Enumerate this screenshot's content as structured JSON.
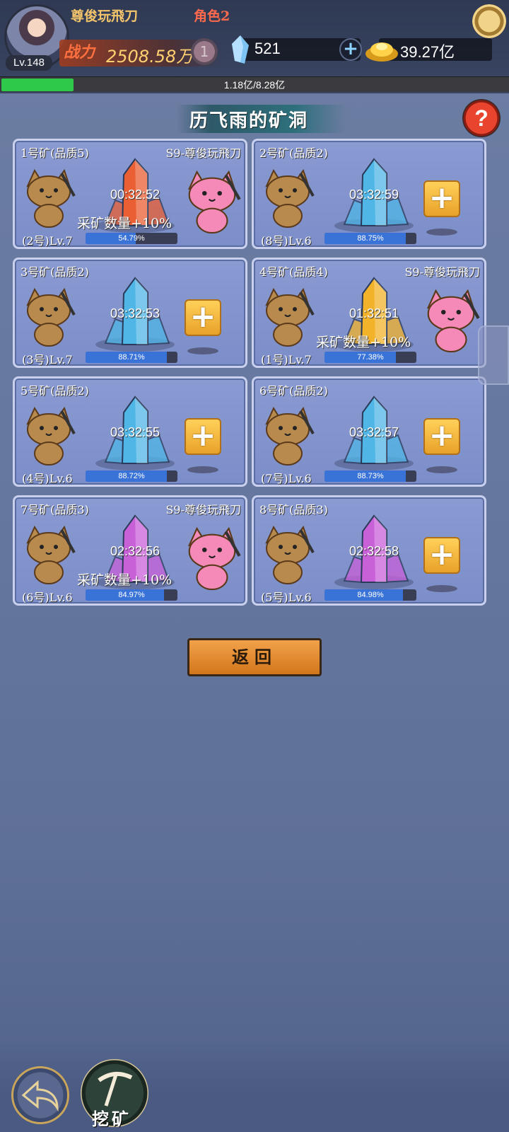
{
  "header": {
    "player_name": "尊俊玩飛刀",
    "role_label": "角色2",
    "level": "Lv.148",
    "power_label": "战力",
    "power_value": "2508.58万",
    "vip_number": "1",
    "gems": "521",
    "gold": "39.27亿",
    "exp_text": "1.18亿/8.28亿",
    "exp_fraction": 0.1425
  },
  "title": "历飞雨的矿洞",
  "help_label": "?",
  "mines": [
    {
      "title": "1号矿(品质5)",
      "owner": "S9-尊俊玩飛刀",
      "timer": "00:32:52",
      "bonus": "采矿数量+10%",
      "worker": "(2号)Lv.7",
      "progress": "54.79%",
      "fraction": 0.5479,
      "crystal": "#ea5f33",
      "occupied": true
    },
    {
      "title": "2号矿(品质2)",
      "owner": "",
      "timer": "03:32:59",
      "bonus": "",
      "worker": "(8号)Lv.6",
      "progress": "88.75%",
      "fraction": 0.8875,
      "crystal": "#4fb6e6",
      "occupied": false
    },
    {
      "title": "3号矿(品质2)",
      "owner": "",
      "timer": "03:32:53",
      "bonus": "",
      "worker": "(3号)Lv.7",
      "progress": "88.71%",
      "fraction": 0.8871,
      "crystal": "#4fb6e6",
      "occupied": false
    },
    {
      "title": "4号矿(品质4)",
      "owner": "S9-尊俊玩飛刀",
      "timer": "01:32:51",
      "bonus": "采矿数量+10%",
      "worker": "(1号)Lv.7",
      "progress": "77.38%",
      "fraction": 0.7738,
      "crystal": "#f2b22a",
      "occupied": true
    },
    {
      "title": "5号矿(品质2)",
      "owner": "",
      "timer": "03:32:55",
      "bonus": "",
      "worker": "(4号)Lv.6",
      "progress": "88.72%",
      "fraction": 0.8872,
      "crystal": "#4fb6e6",
      "occupied": false
    },
    {
      "title": "6号矿(品质2)",
      "owner": "",
      "timer": "03:32:57",
      "bonus": "",
      "worker": "(7号)Lv.6",
      "progress": "88.73%",
      "fraction": 0.8873,
      "crystal": "#4fb6e6",
      "occupied": false
    },
    {
      "title": "7号矿(品质3)",
      "owner": "S9-尊俊玩飛刀",
      "timer": "02:32:56",
      "bonus": "采矿数量+10%",
      "worker": "(6号)Lv.6",
      "progress": "84.97%",
      "fraction": 0.8497,
      "crystal": "#c860d8",
      "occupied": true
    },
    {
      "title": "8号矿(品质3)",
      "owner": "",
      "timer": "02:32:58",
      "bonus": "",
      "worker": "(5号)Lv.6",
      "progress": "84.98%",
      "fraction": 0.8498,
      "crystal": "#c860d8",
      "occupied": false
    }
  ],
  "return_label": "返回",
  "mine_button_label": "挖矿",
  "icons": {
    "settings": "gear-icon",
    "gem": "crystal-gem-icon",
    "gold": "gold-ingot-icon",
    "back": "back-arrow-icon",
    "mine": "pickaxe-icon"
  }
}
